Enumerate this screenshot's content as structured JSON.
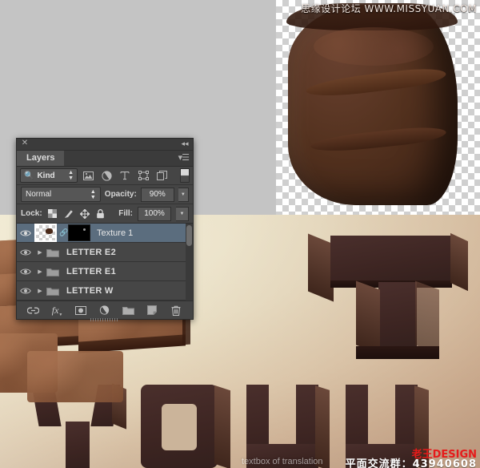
{
  "app": {
    "panel_title": "Layers",
    "close_icon": "close-icon",
    "collapse_icon": "double-chevron-left-icon",
    "menu_icon": "panel-menu-icon"
  },
  "filter_bar": {
    "kind_label": "Kind",
    "search_icon": "search-icon",
    "stepper_icon": "up-down-arrows-icon",
    "filters": [
      {
        "name": "filter-pixel-layers",
        "icon": "image-icon",
        "title": "Filter for pixel layers"
      },
      {
        "name": "filter-adjustment-layers",
        "icon": "adjustment-circle-icon",
        "title": "Filter for adjustment layers"
      },
      {
        "name": "filter-type-layers",
        "icon": "type-T-icon",
        "title": "Filter for type layers"
      },
      {
        "name": "filter-shape-layers",
        "icon": "shape-bounding-box-icon",
        "title": "Filter for shape layers"
      },
      {
        "name": "filter-smart-objects",
        "icon": "smart-object-icon",
        "title": "Filter for smart objects"
      }
    ],
    "toggle_name": "filter-enable-toggle"
  },
  "blend_bar": {
    "blend_mode": "Normal",
    "opacity_label": "Opacity:",
    "opacity_value": "90%",
    "fill_label": "Fill:",
    "fill_value": "100%"
  },
  "lock_bar": {
    "label": "Lock:",
    "buttons": [
      {
        "name": "lock-transparent-pixels",
        "icon": "checkerboard-icon"
      },
      {
        "name": "lock-image-pixels",
        "icon": "brush-icon"
      },
      {
        "name": "lock-position",
        "icon": "move-arrows-icon"
      },
      {
        "name": "lock-all",
        "icon": "lock-icon"
      }
    ]
  },
  "layers": [
    {
      "name": "Texture 1",
      "type": "pixel",
      "selected": true,
      "visible": true,
      "has_mask": true,
      "linked": true,
      "eye_icon": "eye-icon",
      "thumb_icon": "layer-thumbnail",
      "mask_icon": "layer-mask-thumbnail",
      "link_icon": "link-icon"
    },
    {
      "name": "LETTER E2",
      "type": "group",
      "selected": false,
      "visible": true,
      "expanded": false,
      "eye_icon": "eye-icon",
      "disclosure_icon": "triangle-right-icon",
      "folder_icon": "folder-icon"
    },
    {
      "name": "LETTER E1",
      "type": "group",
      "selected": false,
      "visible": true,
      "expanded": false,
      "eye_icon": "eye-icon",
      "disclosure_icon": "triangle-right-icon",
      "folder_icon": "folder-icon"
    },
    {
      "name": "LETTER W",
      "type": "group",
      "selected": false,
      "visible": true,
      "expanded": false,
      "eye_icon": "eye-icon",
      "disclosure_icon": "triangle-right-icon",
      "folder_icon": "folder-icon"
    }
  ],
  "footer_buttons": [
    {
      "name": "link-layers-button",
      "icon": "link-icon",
      "glyph": "link"
    },
    {
      "name": "layer-style-button",
      "icon": "fx-icon",
      "glyph": "fx"
    },
    {
      "name": "add-layer-mask-button",
      "icon": "layer-mask-icon",
      "glyph": "mask"
    },
    {
      "name": "new-adjustment-layer-button",
      "icon": "adjustment-circle-icon",
      "glyph": "adjust"
    },
    {
      "name": "new-group-button",
      "icon": "folder-icon",
      "glyph": "folder"
    },
    {
      "name": "new-layer-button",
      "icon": "new-layer-icon",
      "glyph": "newlayer"
    },
    {
      "name": "delete-layer-button",
      "icon": "trash-icon",
      "glyph": "trash"
    }
  ],
  "watermarks": {
    "top_right": "思缘设计论坛 WWW.MISSYUAN.COM",
    "tooltip": "textbox of translation",
    "logo": "老王DESIGN",
    "qq_group": "平面交流群：43940608"
  },
  "colors": {
    "panel_bg": "#434343",
    "panel_row": "#464646",
    "selected_row": "#5b6d7e",
    "text": "#e6e6e6",
    "canvas_grey": "#c4c4c4",
    "art_cream": "#efe9d2",
    "choc_dark": "#3d2522",
    "choc_light": "#8b5a3c",
    "logo_red": "#e61a1a"
  }
}
